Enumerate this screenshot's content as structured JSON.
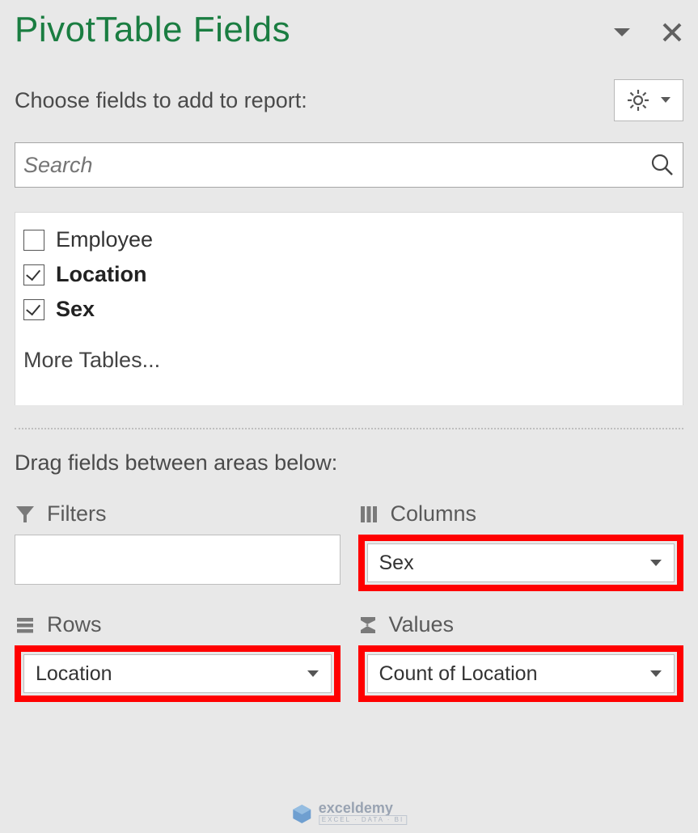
{
  "header": {
    "title": "PivotTable Fields"
  },
  "subtitle": "Choose fields to add to report:",
  "search": {
    "placeholder": "Search"
  },
  "fields": {
    "items": [
      {
        "label": "Employee",
        "checked": false,
        "bold": false
      },
      {
        "label": "Location",
        "checked": true,
        "bold": true
      },
      {
        "label": "Sex",
        "checked": true,
        "bold": true
      }
    ],
    "more": "More Tables..."
  },
  "drag_label": "Drag fields between areas below:",
  "areas": {
    "filters": {
      "header": "Filters",
      "value": ""
    },
    "columns": {
      "header": "Columns",
      "value": "Sex"
    },
    "rows": {
      "header": "Rows",
      "value": "Location"
    },
    "values": {
      "header": "Values",
      "value": "Count of Location"
    }
  },
  "watermark": {
    "main": "exceldemy",
    "sub": "EXCEL · DATA · BI"
  }
}
